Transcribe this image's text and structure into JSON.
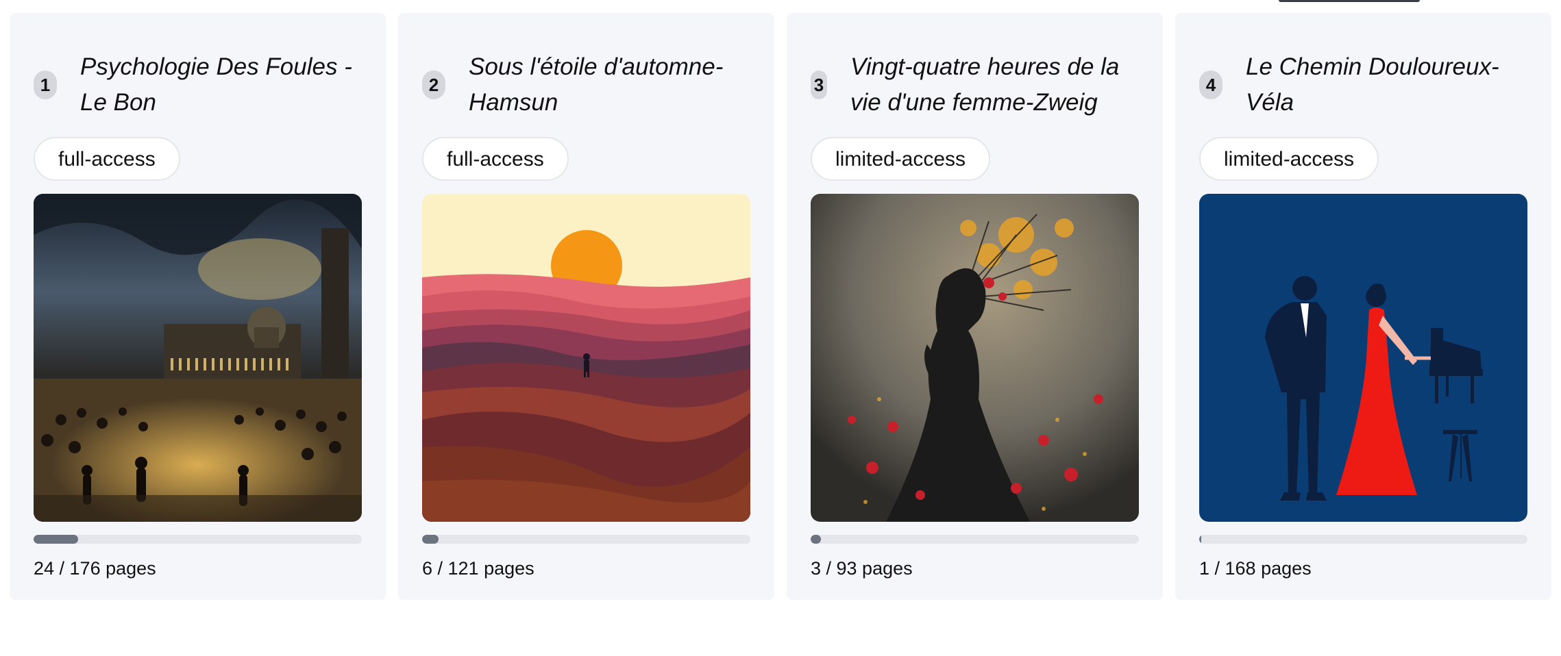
{
  "books": [
    {
      "rank": "1",
      "title": "Psychologie Des Foules - Le Bon",
      "access": "full-access",
      "cover_icon": "crowd-before-domed-building-image",
      "progress_fraction": 0.136,
      "pages_text": "24 / 176 pages"
    },
    {
      "rank": "2",
      "title": "Sous l'étoile d'automne-Hamsun",
      "access": "full-access",
      "cover_icon": "sunset-over-hills-image",
      "progress_fraction": 0.05,
      "pages_text": "6 / 121 pages"
    },
    {
      "rank": "3",
      "title": "Vingt-quatre heures de la vie d'une femme-Zweig",
      "access": "limited-access",
      "cover_icon": "woman-silhouette-with-flowers-image",
      "progress_fraction": 0.032,
      "pages_text": "3 / 93 pages"
    },
    {
      "rank": "4",
      "title": "Le Chemin Douloureux-Véla",
      "access": "limited-access",
      "cover_icon": "couple-and-piano-image",
      "progress_fraction": 0.006,
      "pages_text": "1 / 168 pages"
    }
  ],
  "colors": {
    "card_bg": "#f5f6fa",
    "badge_bg": "#d5d7dc",
    "progress_fill": "#6b7280",
    "progress_track": "#e4e6eb"
  }
}
